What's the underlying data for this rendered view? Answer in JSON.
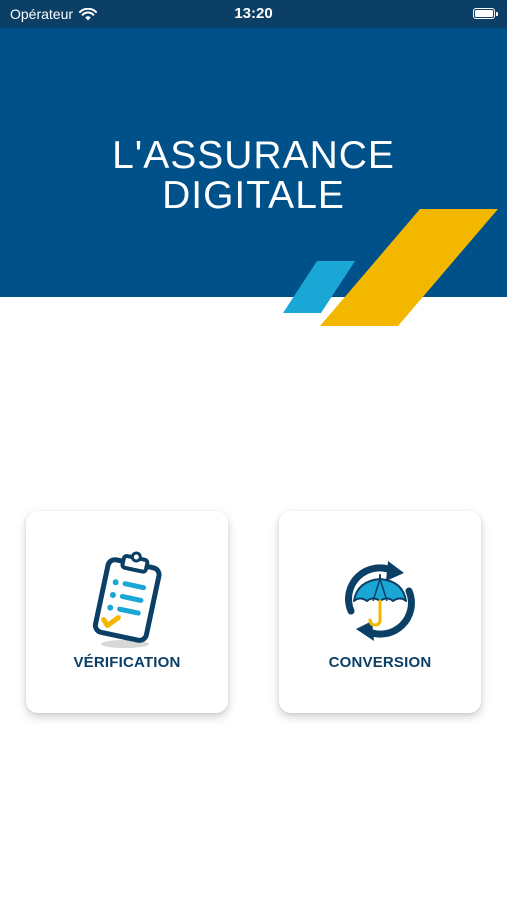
{
  "status_bar": {
    "carrier": "Opérateur",
    "time": "13:20",
    "battery_level": 1.0
  },
  "hero": {
    "title_line1": "L'ASSURANCE",
    "title_line2": "DIGITALE"
  },
  "actions": [
    {
      "label": "VÉRIFICATION",
      "icon": "clipboard-checklist-icon"
    },
    {
      "label": "CONVERSION",
      "icon": "umbrella-refresh-icon"
    }
  ],
  "colors": {
    "brand_blue": "#005189",
    "status_bar": "#0b3f66",
    "accent_yellow": "#f3b700",
    "accent_cyan": "#1aa7d6",
    "label_blue": "#0b3f66"
  }
}
